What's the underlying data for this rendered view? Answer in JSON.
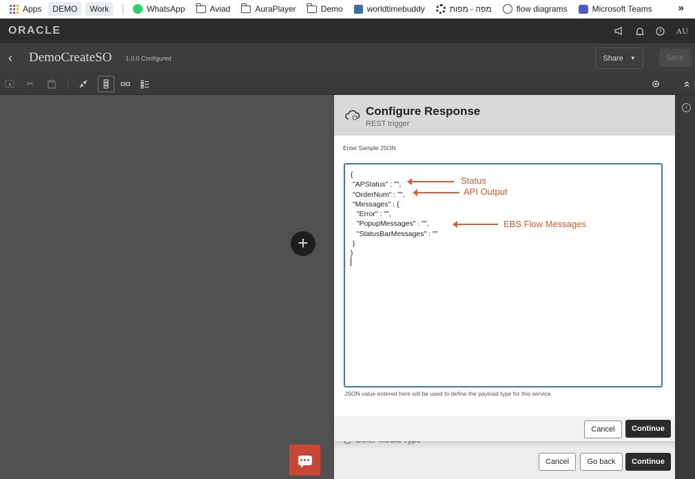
{
  "bookmarks": {
    "items": [
      {
        "label": "Apps",
        "icon": "apps-grid-icon"
      },
      {
        "label": "DEMO",
        "icon": "none"
      },
      {
        "label": "Work",
        "icon": "none"
      },
      {
        "label": "WhatsApp",
        "icon": "whatsapp-icon"
      },
      {
        "label": "Aviad",
        "icon": "folder-icon"
      },
      {
        "label": "AuraPlayer",
        "icon": "folder-icon"
      },
      {
        "label": "Demo",
        "icon": "folder-icon"
      },
      {
        "label": "worldtimebuddy",
        "icon": "worldtimebuddy-icon"
      },
      {
        "label": "מפה - מפות",
        "icon": "settings-icon"
      },
      {
        "label": "flow diagrams",
        "icon": "globe-icon"
      },
      {
        "label": "Microsoft Teams",
        "icon": "teams-icon"
      }
    ],
    "more": "»"
  },
  "header": {
    "logo": "ORACLE",
    "user_initials": "AU"
  },
  "integration": {
    "name": "DemoCreateSO",
    "version": "1.0.0 Configured",
    "share_label": "Share",
    "save_label": "Save"
  },
  "panel": {
    "title": "Configure Response",
    "subtitle": "REST trigger",
    "json_label": "Enter Sample JSON",
    "json_lines": [
      "{",
      " \"APStatus\" : \"\",",
      " \"OrderNum\" : \"\",",
      " \"Messages\" : {",
      "   \"Error\" : \"\",",
      "   \"PopupMessages\" : \"\",",
      "   \"StatusBarMessages\" : \"\"",
      " }",
      "}"
    ],
    "annotations": {
      "status": "Status",
      "api_output": "API Output",
      "ebs_flow_messages": "EBS Flow Messages"
    },
    "json_hint": "JSON value entered here will be used to define the payload type for this service.",
    "cancel_label": "Cancel",
    "continue_label": "Continue"
  },
  "underlying_dialog": {
    "other_media_label": "Other Media Type",
    "cancel_label": "Cancel",
    "go_back_label": "Go back",
    "continue_label": "Continue"
  },
  "colors": {
    "annotation": "#e05a2b",
    "json_box_border": "#2f7fb0",
    "primary_button": "#2b2b2b",
    "chat_button": "#c74634"
  }
}
